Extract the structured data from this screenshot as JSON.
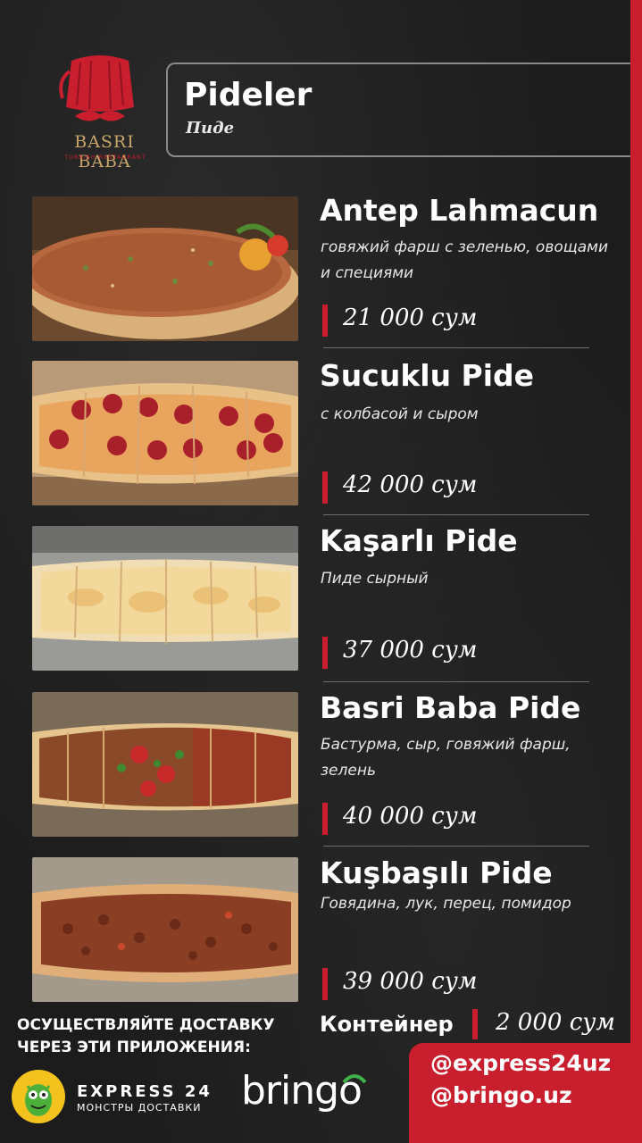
{
  "brand": {
    "name": "BASRI BABA",
    "subtitle": "TURKISH RESTAURANT",
    "accent": "#c81e2e",
    "gold": "#c9a56a"
  },
  "header": {
    "title": "Pideler",
    "subtitle": "Пиде"
  },
  "items": [
    {
      "title": "Antep Lahmacun",
      "desc": "говяжий фарш с зеленью, овощами и специями",
      "price": "21 000 сум"
    },
    {
      "title": "Sucuklu Pide",
      "desc": "с колбасой и сыром",
      "price": "42 000 сум"
    },
    {
      "title": "Kaşarlı Pide",
      "desc": "Пиде сырный",
      "price": "37 000 сум"
    },
    {
      "title": "Basri Baba Pide",
      "desc": "Бастурма, сыр, говяжий фарш, зелень",
      "price": "40 000 сум"
    },
    {
      "title": " Kuşbaşılı Pide",
      "desc": "Говядина, лук, перец, помидор",
      "price": "39 000 сум"
    }
  ],
  "container": {
    "label": "Контейнер",
    "price": "2 000 сум"
  },
  "delivery": {
    "line1": "ОСУЩЕСТВЛЯЙТЕ ДОСТАВКУ",
    "line2": "ЧЕРЕЗ ЭТИ ПРИЛОЖЕНИЯ:",
    "express_name": "EXPRESS 24",
    "express_sub": "МОНСТРЫ ДОСТАВКИ",
    "bringo": "bringo"
  },
  "social": {
    "handle1": "@express24uz",
    "handle2": "@bringo.uz"
  }
}
